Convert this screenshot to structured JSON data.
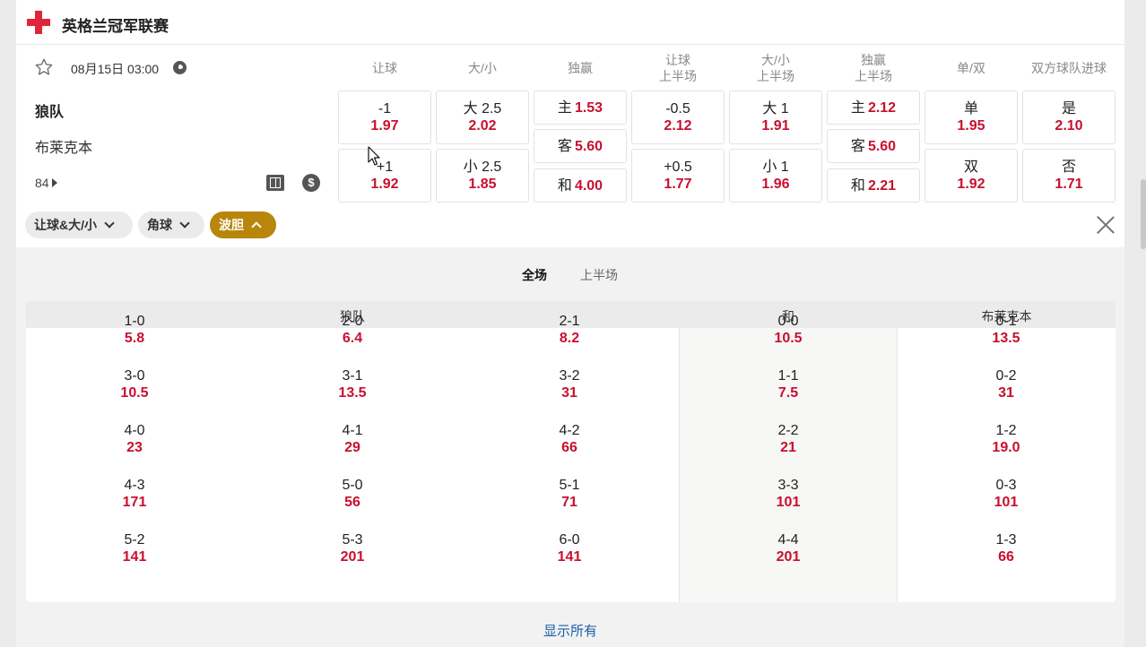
{
  "league": {
    "name": "英格兰冠军联赛"
  },
  "match": {
    "datetime": "08月15日 03:00",
    "home_team": "狼队",
    "away_team": "布莱克本",
    "more_markets_count": "84"
  },
  "columns": [
    {
      "line1": "让球",
      "line2": ""
    },
    {
      "line1": "大/小",
      "line2": ""
    },
    {
      "line1": "独赢",
      "line2": ""
    },
    {
      "line1": "让球",
      "line2": "上半场"
    },
    {
      "line1": "大/小",
      "line2": "上半场"
    },
    {
      "line1": "独赢",
      "line2": "上半场"
    },
    {
      "line1": "单/双",
      "line2": ""
    },
    {
      "line1": "双方球队进球",
      "line2": ""
    }
  ],
  "odds": {
    "handicap_full": [
      {
        "label": "-1",
        "odd": "1.97"
      },
      {
        "label": "+1",
        "odd": "1.92"
      }
    ],
    "ou_full": [
      {
        "label": "大 2.5",
        "odd": "2.02"
      },
      {
        "label": "小 2.5",
        "odd": "1.85"
      }
    ],
    "moneyline_full": [
      {
        "label": "主",
        "odd": "1.53"
      },
      {
        "label": "客",
        "odd": "5.60"
      },
      {
        "label": "和",
        "odd": "4.00"
      }
    ],
    "handicap_half": [
      {
        "label": "-0.5",
        "odd": "2.12"
      },
      {
        "label": "+0.5",
        "odd": "1.77"
      }
    ],
    "ou_half": [
      {
        "label": "大 1",
        "odd": "1.91"
      },
      {
        "label": "小 1",
        "odd": "1.96"
      }
    ],
    "moneyline_half": [
      {
        "label": "主",
        "odd": "2.12"
      },
      {
        "label": "客",
        "odd": "5.60"
      },
      {
        "label": "和",
        "odd": "2.21"
      }
    ],
    "odd_even": [
      {
        "label": "单",
        "odd": "1.95"
      },
      {
        "label": "双",
        "odd": "1.92"
      }
    ],
    "btts": [
      {
        "label": "是",
        "odd": "2.10"
      },
      {
        "label": "否",
        "odd": "1.71"
      }
    ]
  },
  "filters": [
    {
      "label": "让球&大/小",
      "active": false
    },
    {
      "label": "角球",
      "active": false
    },
    {
      "label": "波胆",
      "active": true
    }
  ],
  "correct_score": {
    "tabs": [
      {
        "label": "全场",
        "active": true
      },
      {
        "label": "上半场",
        "active": false
      }
    ],
    "groups": {
      "home": "狼队",
      "draw": "和",
      "away": "布莱克本"
    },
    "home_rows": [
      [
        {
          "score": "1-0",
          "odd": "5.8"
        },
        {
          "score": "2-0",
          "odd": "6.4"
        },
        {
          "score": "2-1",
          "odd": "8.2"
        }
      ],
      [
        {
          "score": "3-0",
          "odd": "10.5"
        },
        {
          "score": "3-1",
          "odd": "13.5"
        },
        {
          "score": "3-2",
          "odd": "31"
        }
      ],
      [
        {
          "score": "4-0",
          "odd": "23"
        },
        {
          "score": "4-1",
          "odd": "29"
        },
        {
          "score": "4-2",
          "odd": "66"
        }
      ],
      [
        {
          "score": "4-3",
          "odd": "171"
        },
        {
          "score": "5-0",
          "odd": "56"
        },
        {
          "score": "5-1",
          "odd": "71"
        }
      ],
      [
        {
          "score": "5-2",
          "odd": "141"
        },
        {
          "score": "5-3",
          "odd": "201"
        },
        {
          "score": "6-0",
          "odd": "141"
        }
      ]
    ],
    "draw_rows": [
      {
        "score": "0-0",
        "odd": "10.5"
      },
      {
        "score": "1-1",
        "odd": "7.5"
      },
      {
        "score": "2-2",
        "odd": "21"
      },
      {
        "score": "3-3",
        "odd": "101"
      },
      {
        "score": "4-4",
        "odd": "201"
      }
    ],
    "away_rows": [
      {
        "score": "0-1",
        "odd": "13.5"
      },
      {
        "score": "0-2",
        "odd": "31"
      },
      {
        "score": "1-2",
        "odd": "19.0"
      },
      {
        "score": "0-3",
        "odd": "101"
      },
      {
        "score": "1-3",
        "odd": "66"
      }
    ],
    "show_all_label": "显示所有"
  },
  "colors": {
    "accent": "#c8102e",
    "active_pill": "#b8860b",
    "link": "#1a5fa8",
    "league_icon": "#e0253a"
  },
  "icons": {
    "league": "red-cross-icon",
    "favorite": "star-icon",
    "live": "clock-icon",
    "pitch": "pitch-icon",
    "cashout": "dollar-icon",
    "close": "close-icon"
  }
}
